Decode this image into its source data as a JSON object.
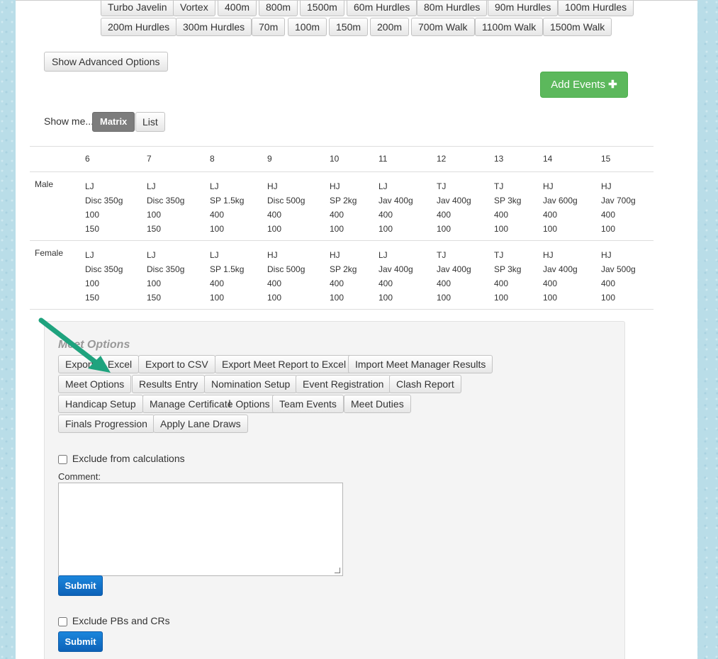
{
  "events": {
    "row1": [
      "Turbo Javelin",
      "Vortex",
      "400m",
      "800m",
      "1500m",
      "60m Hurdles",
      "80m Hurdles",
      "90m Hurdles",
      "100m Hurdles"
    ],
    "row2": [
      "200m Hurdles",
      "300m Hurdles",
      "70m",
      "100m",
      "150m",
      "200m",
      "700m Walk",
      "1100m Walk",
      "1500m Walk"
    ]
  },
  "advanced_label": "Show Advanced Options",
  "add_events_label": "Add Events",
  "add_events_icon": "plus-icon",
  "view_toggle": {
    "prefix": "Show me...",
    "matrix": "Matrix",
    "list": "List"
  },
  "matrix": {
    "ages": [
      "6",
      "7",
      "8",
      "9",
      "10",
      "11",
      "12",
      "13",
      "14",
      "15"
    ],
    "groups": [
      {
        "label": "Male",
        "cells": [
          [
            "LJ",
            "Disc 350g",
            "100",
            "150"
          ],
          [
            "LJ",
            "Disc 350g",
            "100",
            "150"
          ],
          [
            "LJ",
            "SP 1.5kg",
            "400",
            "100"
          ],
          [
            "HJ",
            "Disc 500g",
            "400",
            "100"
          ],
          [
            "HJ",
            "SP 2kg",
            "400",
            "100"
          ],
          [
            "LJ",
            "Jav 400g",
            "400",
            "100"
          ],
          [
            "TJ",
            "Jav 400g",
            "400",
            "100"
          ],
          [
            "TJ",
            "SP 3kg",
            "400",
            "100"
          ],
          [
            "HJ",
            "Jav 600g",
            "400",
            "100"
          ],
          [
            "HJ",
            "Jav 700g",
            "400",
            "100"
          ]
        ]
      },
      {
        "label": "Female",
        "cells": [
          [
            "LJ",
            "Disc 350g",
            "100",
            "150"
          ],
          [
            "LJ",
            "Disc 350g",
            "100",
            "150"
          ],
          [
            "LJ",
            "SP 1.5kg",
            "400",
            "100"
          ],
          [
            "HJ",
            "Disc 500g",
            "400",
            "100"
          ],
          [
            "HJ",
            "SP 2kg",
            "400",
            "100"
          ],
          [
            "LJ",
            "Jav 400g",
            "400",
            "100"
          ],
          [
            "TJ",
            "Jav 400g",
            "400",
            "100"
          ],
          [
            "TJ",
            "SP 3kg",
            "400",
            "100"
          ],
          [
            "HJ",
            "Jav 400g",
            "400",
            "100"
          ],
          [
            "HJ",
            "Jav 500g",
            "400",
            "100"
          ]
        ]
      }
    ]
  },
  "meet_options": {
    "title": "Meet Options",
    "rows": [
      [
        "Export to Excel",
        "Export to CSV",
        "Export Meet Report to Excel",
        "Import Meet Manager Results"
      ],
      [
        "Meet Options",
        "Results Entry",
        "Nomination Setup",
        "Event Registration",
        "Clash Report"
      ],
      [
        "Handicap Setup",
        "Manage Certificate Options",
        "Team Events",
        "Meet Duties"
      ],
      [
        "Finals Progression",
        "Apply Lane Draws"
      ]
    ],
    "exclude_calc_label": "Exclude from calculations",
    "comment_label": "Comment:",
    "comment_value": "",
    "submit_label": "Submit",
    "exclude_pb_label": "Exclude PBs and CRs",
    "submit2_label": "Submit"
  },
  "colors": {
    "add_button": "#5cb85c",
    "submit": "#0c62b8",
    "arrow": "#1fa37e",
    "matrix_toggle": "#7d7d7d"
  }
}
